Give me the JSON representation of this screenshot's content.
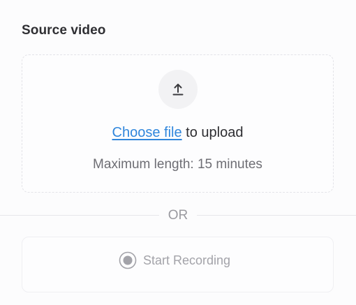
{
  "section": {
    "title": "Source video"
  },
  "upload": {
    "icon": "upload-icon",
    "link_text": "Choose file",
    "suffix_text": " to upload",
    "limit_text": "Maximum length: 15 minutes"
  },
  "divider": {
    "text": "OR"
  },
  "recording": {
    "icon": "record-icon",
    "label": "Start Recording"
  },
  "colors": {
    "link": "#2f86dc",
    "muted": "#a3a3a9",
    "border": "#e3e3e8"
  }
}
